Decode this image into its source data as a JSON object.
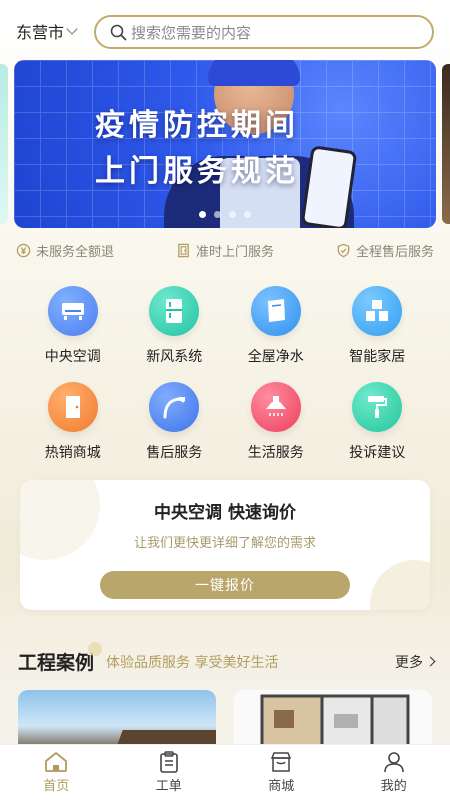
{
  "header": {
    "city": "东营市",
    "search_placeholder": "搜索您需要的内容"
  },
  "banner": {
    "line1": "疫情防控期间",
    "line2": "上门服务规范",
    "slide_count": 4,
    "active_slide": 1
  },
  "guarantees": [
    {
      "label": "未服务全额退",
      "icon": "yen-circle-icon"
    },
    {
      "label": "准时上门服务",
      "icon": "door-icon"
    },
    {
      "label": "全程售后服务",
      "icon": "shield-check-icon"
    }
  ],
  "categories": [
    {
      "label": "中央空调",
      "icon": "air-conditioner-icon",
      "color": "#4f86f0"
    },
    {
      "label": "新风系统",
      "icon": "fresh-air-icon",
      "color": "#2fcfb0"
    },
    {
      "label": "全屋净水",
      "icon": "water-purifier-icon",
      "color": "#3a9df2"
    },
    {
      "label": "智能家居",
      "icon": "smart-home-icon",
      "color": "#3ea3f0"
    },
    {
      "label": "热销商城",
      "icon": "store-door-icon",
      "color": "#f4893a"
    },
    {
      "label": "售后服务",
      "icon": "faucet-icon",
      "color": "#4a86f0"
    },
    {
      "label": "生活服务",
      "icon": "range-hood-icon",
      "color": "#f2506a"
    },
    {
      "label": "投诉建议",
      "icon": "paint-roller-icon",
      "color": "#2fcfa6"
    }
  ],
  "inquiry": {
    "title": "中央空调  快速询价",
    "subtitle": "让我们更快更详细了解您的需求",
    "button": "一键报价"
  },
  "projects": {
    "title": "工程案例",
    "subtitle": "体验品质服务  享受美好生活",
    "more": "更多"
  },
  "tabbar": [
    {
      "label": "首页",
      "icon": "home-icon",
      "active": true
    },
    {
      "label": "工单",
      "icon": "clipboard-icon",
      "active": false
    },
    {
      "label": "商城",
      "icon": "shop-icon",
      "active": false
    },
    {
      "label": "我的",
      "icon": "user-icon",
      "active": false
    }
  ],
  "colors": {
    "accent": "#b9a66b",
    "accent_text": "#b39e61",
    "banner_blue": "#2e59ea"
  }
}
